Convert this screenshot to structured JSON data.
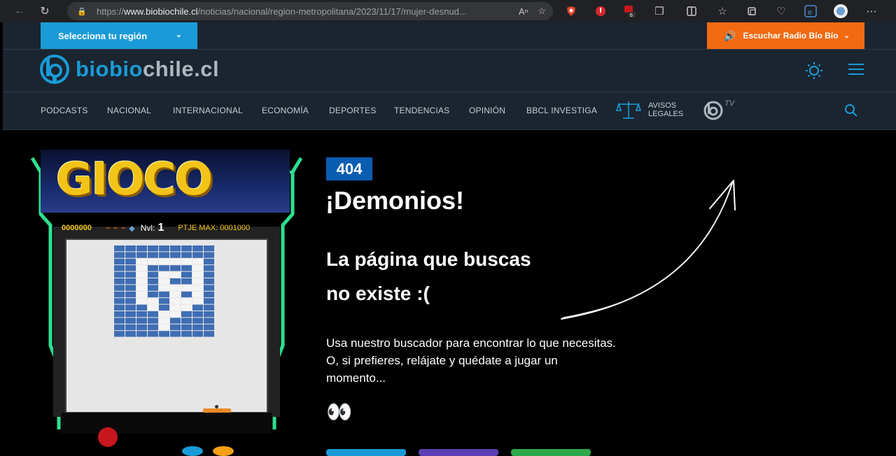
{
  "browser": {
    "url_prefix": "https://",
    "url_host": "www.biobiochile.cl",
    "url_path": "/noticias/nacional/region-metropolitana/2023/11/17/mujer-desnud...",
    "ext_badge_count": "6"
  },
  "site": {
    "region_label": "Selecciona tu región",
    "radio_label": "Escuchar Radio Bío Bío",
    "logo_part1": "biobio",
    "logo_part2": "chile.cl",
    "nav": [
      "PODCASTS",
      "NACIONAL",
      "INTERNACIONAL",
      "ECONOMÍA",
      "DEPORTES",
      "TENDENCIAS",
      "OPINIÓN",
      "BBCL INVESTIGA"
    ],
    "avisos_line1": "AVISOS",
    "avisos_line2": "LEGALES",
    "tv_label": "TV"
  },
  "game": {
    "title": "GIOCO",
    "score": "0000000",
    "lives": "– – –",
    "level_label": "Nvl:",
    "level_value": "1",
    "max_score": "PTJE MAX: 0001000"
  },
  "content": {
    "badge": "404",
    "heading": "¡Demonios!",
    "subheading_line1": "La página que buscas",
    "subheading_line2": "no existe :(",
    "paragraph_line1": "Usa nuestro buscador para encontrar lo que necesitas.",
    "paragraph_line2": "O, si prefieres, relájate y quédate a jugar un",
    "paragraph_line3": "momento...",
    "emoji": "👀"
  },
  "colors": {
    "accent_blue": "#1a9bd7",
    "radio_orange": "#f26a12",
    "badge_blue": "#0a5db0",
    "arcade_green": "#2de08f",
    "brick_blue": "#3f6db3"
  }
}
